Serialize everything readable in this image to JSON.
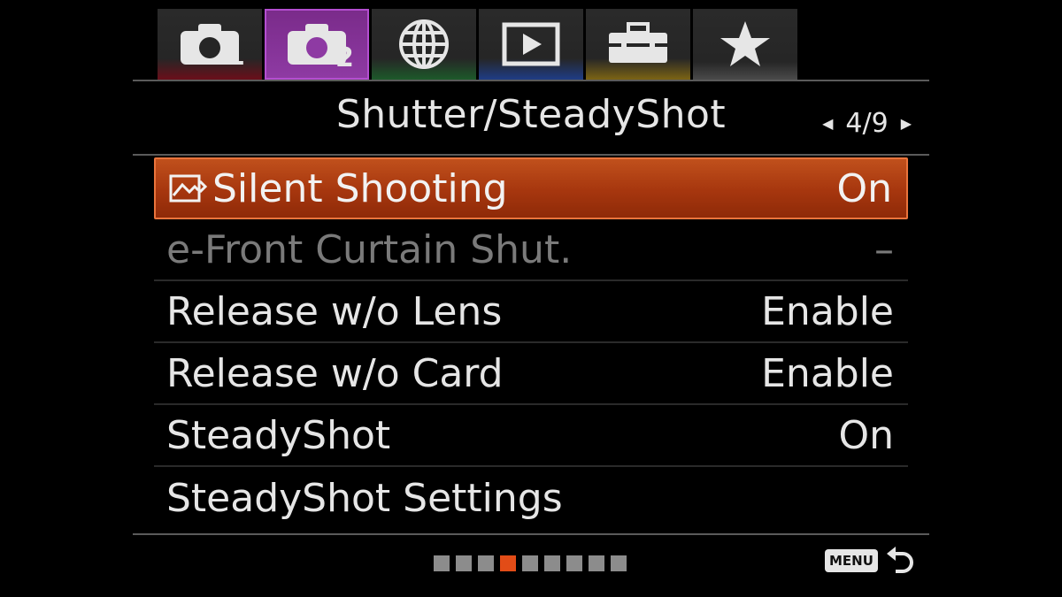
{
  "tabs": [
    {
      "id": "shooting1",
      "icon": "camera-icon",
      "num": "1",
      "active": false
    },
    {
      "id": "shooting2",
      "icon": "camera-icon",
      "num": "2",
      "active": true
    },
    {
      "id": "network",
      "icon": "globe-icon",
      "num": "",
      "active": false
    },
    {
      "id": "playback",
      "icon": "play-icon",
      "num": "",
      "active": false
    },
    {
      "id": "setup",
      "icon": "toolbox-icon",
      "num": "",
      "active": false
    },
    {
      "id": "mymenu",
      "icon": "star-icon",
      "num": "",
      "active": false
    }
  ],
  "header": {
    "title": "Shutter/SteadyShot",
    "page": "4/9"
  },
  "menu": {
    "items": [
      {
        "label": "Silent Shooting",
        "value": "On"
      },
      {
        "label": "e-Front Curtain Shut.",
        "value": "–"
      },
      {
        "label": "Release w/o Lens",
        "value": "Enable"
      },
      {
        "label": "Release w/o Card",
        "value": "Enable"
      },
      {
        "label": "SteadyShot",
        "value": "On"
      },
      {
        "label": "SteadyShot Settings",
        "value": ""
      }
    ]
  },
  "page_indicator": {
    "total": 9,
    "current": 4
  },
  "footer": {
    "menu_label": "MENU"
  },
  "colors": {
    "accent": "#c0501c",
    "tab_active": "#8e3aa3",
    "dot_active": "#e24c17"
  }
}
